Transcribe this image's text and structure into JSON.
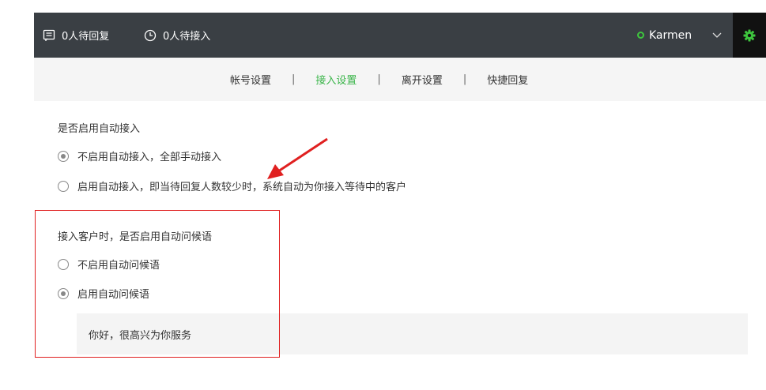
{
  "topbar": {
    "pending_reply": "0人待回复",
    "pending_accept": "0人待接入",
    "username": "Karmen",
    "icons": {
      "reply": "message-icon",
      "clock": "clock-icon",
      "caret": "chevron-down-icon",
      "gear": "gear-icon"
    },
    "colors": {
      "online": "#3ec63e",
      "gear": "#3ec63e",
      "bar": "#3a3f44"
    }
  },
  "tabs": [
    {
      "label": "帐号设置",
      "active": false
    },
    {
      "label": "接入设置",
      "active": true
    },
    {
      "label": "离开设置",
      "active": false
    },
    {
      "label": "快捷回复",
      "active": false
    }
  ],
  "tab_separator": "|",
  "auto_accept": {
    "title": "是否启用自动接入",
    "options": [
      {
        "label": "不启用自动接入，全部手动接入",
        "checked": true
      },
      {
        "label": "启用自动接入，即当待回复人数较少时，系统自动为你接入等待中的客户",
        "checked": false
      }
    ]
  },
  "auto_greeting": {
    "title": "接入客户时，是否启用自动问候语",
    "options": [
      {
        "label": "不启用自动问候语",
        "checked": false
      },
      {
        "label": "启用自动问候语",
        "checked": true
      }
    ],
    "greeting_text": "你好，很高兴为你服务"
  },
  "annotation_color": "#e02020",
  "accent_color": "#3bb54a"
}
